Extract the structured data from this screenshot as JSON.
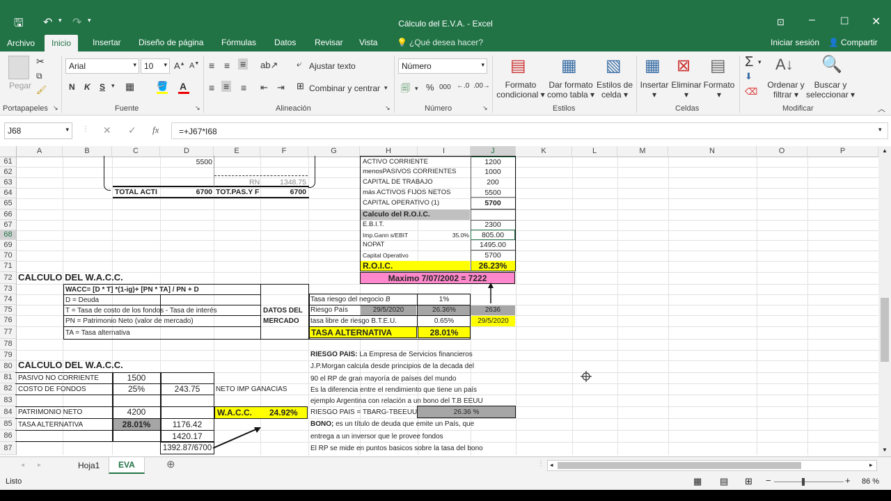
{
  "window": {
    "title": "Cálculo del E.V.A. - Excel"
  },
  "tabs": [
    "Archivo",
    "Inicio",
    "Insertar",
    "Diseño de página",
    "Fórmulas",
    "Datos",
    "Revisar",
    "Vista"
  ],
  "tell_me": "¿Qué desea hacer?",
  "account": {
    "signin": "Iniciar sesión",
    "share": "Compartir"
  },
  "ribbon": {
    "paste": "Pegar",
    "clipboard": "Portapapeles",
    "font_name": "Arial",
    "font_size": "10",
    "bold": "N",
    "italic": "K",
    "underline": "S",
    "font_group": "Fuente",
    "wrap": "Ajustar texto",
    "merge": "Combinar y centrar",
    "align_group": "Alineación",
    "number_format": "Número",
    "percent": "%",
    "thousands": "000",
    "number_group": "Número",
    "cond_format": [
      "Formato",
      "condicional"
    ],
    "table_format": [
      "Dar formato",
      "como tabla"
    ],
    "cell_styles": [
      "Estilos de",
      "celda"
    ],
    "styles_group": "Estilos",
    "insert": "Insertar",
    "delete": "Eliminar",
    "format": "Formato",
    "cells_group": "Celdas",
    "sort": [
      "Ordenar y",
      "filtrar"
    ],
    "find": [
      "Buscar y",
      "seleccionar"
    ],
    "edit_group": "Modificar"
  },
  "formula_bar": {
    "name_box": "J68",
    "formula": "=+J67*I68",
    "fx": "fx"
  },
  "columns": [
    "A",
    "B",
    "C",
    "D",
    "E",
    "F",
    "G",
    "H",
    "I",
    "J",
    "K",
    "L",
    "M",
    "N",
    "O",
    "P"
  ],
  "rows": [
    "61",
    "62",
    "63",
    "64",
    "65",
    "66",
    "67",
    "68",
    "69",
    "70",
    "71",
    "72",
    "73",
    "74",
    "75",
    "76",
    "77",
    "78",
    "79",
    "80",
    "81",
    "82",
    "83",
    "84",
    "85",
    "86",
    "87"
  ],
  "cells": {
    "d61": "5500",
    "rn": "RN",
    "rn_val": "1348.75",
    "total_act": "TOTAL ACTI",
    "total_act_val": "6700",
    "tot_pas": "TOT.PAS.Y F",
    "tot_pas_val": "6700",
    "h61": "ACTIVO CORRIENTE",
    "j61": "1200",
    "h62": "menosPASIVOS CORRIENTES",
    "j62": "1000",
    "h63": "CAPITAL DE TRABAJO",
    "j63": "200",
    "h64": "más ACTIVOS FIJOS NETOS",
    "j64": "5500",
    "h65": "CAPITAL OPERATIVO (1)",
    "j65": "5700",
    "h66": "Calculo del R.O.I.C.",
    "h67": "E.B.I.T.",
    "j67": "2300",
    "h68": "Imp.Gann s/EBIT",
    "i68": "35.0%",
    "j68": "805.00",
    "h69": "NOPAT",
    "j69": "1495.00",
    "h70": "Capital Operativo",
    "j70": "5700",
    "h71": "R.O.I.C.",
    "j71": "26.23%",
    "h72": "Maximo 7/07/2002 =  7222",
    "a72": "CALCULO DEL W.A.C.C.",
    "b73": "WACC= [D * T] *(1-ig)+ [PN * TA]  / PN + D",
    "b74": "D = Deuda",
    "b75": "T = Tasa de costo de los fondos - Tasa de interés",
    "b76": "PN = Patrimonio Neto (valor de mercado)",
    "b77": "TA = Tasa alternativa",
    "datos1": "DATOS DEL",
    "datos2": "MERCADO",
    "g74": "Tasa riesgo del negocio",
    "g74b": "B",
    "i74": "1%",
    "g75": "Riesgo País",
    "h75": "29/5/2020",
    "i75": "26.36%",
    "j75": "2636",
    "g76": "tasa libre de riesgo B.T.E.U.",
    "i76": "0.65%",
    "j76": "29/5/2020",
    "g77": "TASA ALTERNATIVA",
    "i77": "28.01%",
    "g79a": "RIESGO PAIS:",
    "g79b": " La Empresa de Servicios financieros",
    "g80": "J.P.Morgan calcula desde principios de la decada del",
    "g81": "90 el RP de gran mayoría de países del mundo",
    "g82": "Es la diferencia entre el rendimiento que tiene un país",
    "g83": "ejemplo Argentina con relación a un bono del T.B EEUU",
    "g84": "RIESGO PAIS = TBARG-TBEEUU",
    "i84": "26.36  %",
    "g85a": "BONO;",
    "g85b": " es un título de deuda que emite un País, que",
    "g86": "entrega a un inversor que le provee fondos",
    "g87": "El RP se mide en puntos basicos sobre la tasa del bono",
    "a80": "CALCULO DEL W.A.C.C.",
    "a81": "PASIVO NO CORRIENTE",
    "c81": "1500",
    "a82": "COSTO DE FONDOS",
    "c82": "25%",
    "d82": "243.75",
    "e82": "NETO IMP GANACIAS",
    "a84": "PATRIMONIO NETO",
    "c84": "4200",
    "e84a": "W.A.C.C.",
    "e84b": "24.92%",
    "a85": "TASA ALTERNATIVA",
    "c85": "28.01%",
    "d85": "1176.42",
    "d86": "1420.17",
    "d87": "1392.87/6700"
  },
  "sheets": [
    "Hoja1",
    "EVA"
  ],
  "status": {
    "ready": "Listo",
    "zoom": "86 %"
  },
  "colors": {
    "excel_green": "#217346",
    "yellow": "#ffff00",
    "pink": "#ff88cc",
    "gray": "#a6a6a6"
  }
}
